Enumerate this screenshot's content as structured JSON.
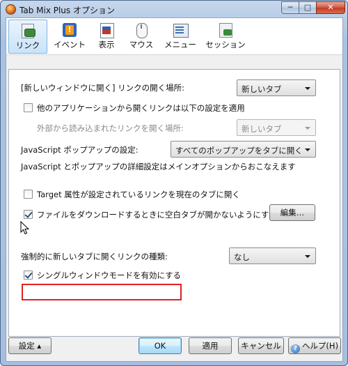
{
  "window": {
    "title": "Tab Mix Plus オプション",
    "min_glyph": "─",
    "max_glyph": "□",
    "close_glyph": "✕"
  },
  "toolbar": {
    "items": [
      {
        "label": "リンク",
        "icon": "link-icon",
        "selected": true
      },
      {
        "label": "イベント",
        "icon": "event-icon"
      },
      {
        "label": "表示",
        "icon": "display-icon"
      },
      {
        "label": "マウス",
        "icon": "mouse-icon"
      },
      {
        "label": "メニュー",
        "icon": "menu-icon"
      },
      {
        "label": "セッション",
        "icon": "session-icon"
      }
    ]
  },
  "links": {
    "open_new_window_label": "[新しいウィンドウに開く] リンクの開く場所:",
    "open_new_window_value": "新しいタブ",
    "external_links_checkbox": "他のアプリケーションから開くリンクは以下の設定を適用",
    "external_links_checked": false,
    "external_load_label": "外部から読み込まれたリンクを開く場所:",
    "external_load_value": "新しいタブ",
    "popup_label": "JavaScript ポップアップの設定:",
    "popup_value": "すべてのポップアップをタブに開く",
    "popup_note": "JavaScript とポップアップの詳細設定はメインオプションからおこなえます",
    "target_checkbox": "Target 属性が設定されているリンクを現在のタブに開く",
    "target_checked": false,
    "download_checkbox": "ファイルをダウンロードするときに空白タブが開かないようにする",
    "download_checked": true,
    "edit_button": "編集…",
    "force_new_tab_label": "強制的に新しいタブに開くリンクの種類:",
    "force_new_tab_value": "なし",
    "single_window_checkbox": "シングルウィンドウモードを有効にする",
    "single_window_checked": true
  },
  "footer": {
    "settings_button": "設定",
    "ok_button": "OK",
    "apply_button": "適用",
    "cancel_button": "キャンセル",
    "help_button": "ヘルプ(H)"
  },
  "colors": {
    "highlight_border": "#e02020",
    "selected_tab_border": "#7eb4e6"
  }
}
